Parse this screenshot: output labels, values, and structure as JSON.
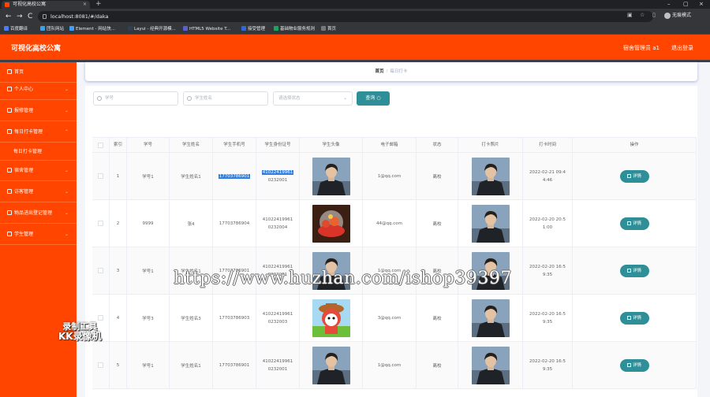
{
  "browser": {
    "tab_title": "可视化高校公寓",
    "tab_close": "×",
    "new_tab": "+",
    "url": "localhost:8081/#/daka",
    "nav_back": "←",
    "nav_forward": "→",
    "nav_reload": "C",
    "guest_label": "无痕模式",
    "win_min": "–",
    "win_max": "▢",
    "win_close": "×",
    "bookmarks": [
      {
        "label": "百度翻译",
        "color": "#4a7df0"
      },
      {
        "label": "团队网站",
        "color": "#3aa0e8"
      },
      {
        "label": "Element - 网站快...",
        "color": "#409eff"
      },
      {
        "label": "Layui - 经典开源模...",
        "color": "#2f4056"
      },
      {
        "label": "HTML5 Website T...",
        "color": "#5a5fd0"
      },
      {
        "label": "接受管理",
        "color": "#2c6bd6"
      },
      {
        "label": "基础物业服务规则",
        "color": "#19a55f"
      },
      {
        "label": "首页",
        "color": "#777"
      }
    ]
  },
  "header": {
    "title": "可视化高校公寓",
    "admin_name": "宿舍管理员 a1",
    "logout": "退出登录"
  },
  "sidebar": {
    "items": [
      {
        "label": "首页",
        "icon": "home-icon",
        "has_children": false
      },
      {
        "label": "个人中心",
        "icon": "user-icon",
        "has_children": true
      },
      {
        "label": "报修管理",
        "icon": "wrench-icon",
        "has_children": true
      },
      {
        "label": "每日打卡管理",
        "icon": "chart-icon",
        "has_children": true
      },
      {
        "label": "宿舍管理",
        "icon": "building-icon",
        "has_children": true
      },
      {
        "label": "访客管理",
        "icon": "visitor-icon",
        "has_children": true
      },
      {
        "label": "物品进出登记管理",
        "icon": "box-icon",
        "has_children": true
      },
      {
        "label": "学生管理",
        "icon": "student-icon",
        "has_children": true
      }
    ],
    "submenu": {
      "label": "每日打卡管理"
    },
    "chevron": "⌄"
  },
  "breadcrumb": {
    "home": "首页",
    "separator": "/",
    "current": "每日打卡"
  },
  "search": {
    "student_no_placeholder": "学号",
    "student_name_placeholder": "学生姓名",
    "status_placeholder": "请选择状态",
    "query_label": "查询",
    "caret": "⌄"
  },
  "table": {
    "headers": [
      "",
      "索引",
      "学号",
      "学生姓名",
      "学生手机号",
      "学生身份证号",
      "学生头像",
      "电子邮箱",
      "状态",
      "打卡照片",
      "打卡时间",
      "操作"
    ],
    "detail_label": "详情",
    "rows": [
      {
        "index": "1",
        "student_no": "学号1",
        "name": "学生姓名1",
        "phone": "17703786901",
        "id_a": "41022419961",
        "id_b": "0232001",
        "email": "1@qq.com",
        "status": "离校",
        "time": "2022-02-21 09:44:46",
        "avatar": "photo",
        "highlight": true
      },
      {
        "index": "2",
        "student_no": "9999",
        "name": "张4",
        "phone": "17703786904",
        "id_a": "41022419961",
        "id_b": "0232004",
        "email": "44@qq.com",
        "status": "离校",
        "time": "2022-02-20 20:51:00",
        "avatar": "fruit",
        "highlight": false
      },
      {
        "index": "3",
        "student_no": "学号1",
        "name": "学生姓名1",
        "phone": "17703786901",
        "id_a": "41022419961",
        "id_b": "0232001",
        "email": "1@qq.com",
        "status": "离校",
        "time": "2022-02-20 16:59:35",
        "avatar": "photo",
        "highlight": false
      },
      {
        "index": "4",
        "student_no": "学号3",
        "name": "学生姓名3",
        "phone": "17703786903",
        "id_a": "41022419961",
        "id_b": "0232003",
        "email": "3@qq.com",
        "status": "离校",
        "time": "2022-02-20 16:59:35",
        "avatar": "cartoon",
        "highlight": false
      },
      {
        "index": "5",
        "student_no": "学号1",
        "name": "学生姓名1",
        "phone": "17703786901",
        "id_a": "41022419961",
        "id_b": "0232001",
        "email": "1@qq.com",
        "status": "离校",
        "time": "2022-02-20 16:59:35",
        "avatar": "photo",
        "highlight": false
      }
    ]
  },
  "watermarks": {
    "url": "https://www.huzhan.com/ishop39397",
    "kk_line1": "录制工具",
    "kk_line2": "KK录像机"
  }
}
